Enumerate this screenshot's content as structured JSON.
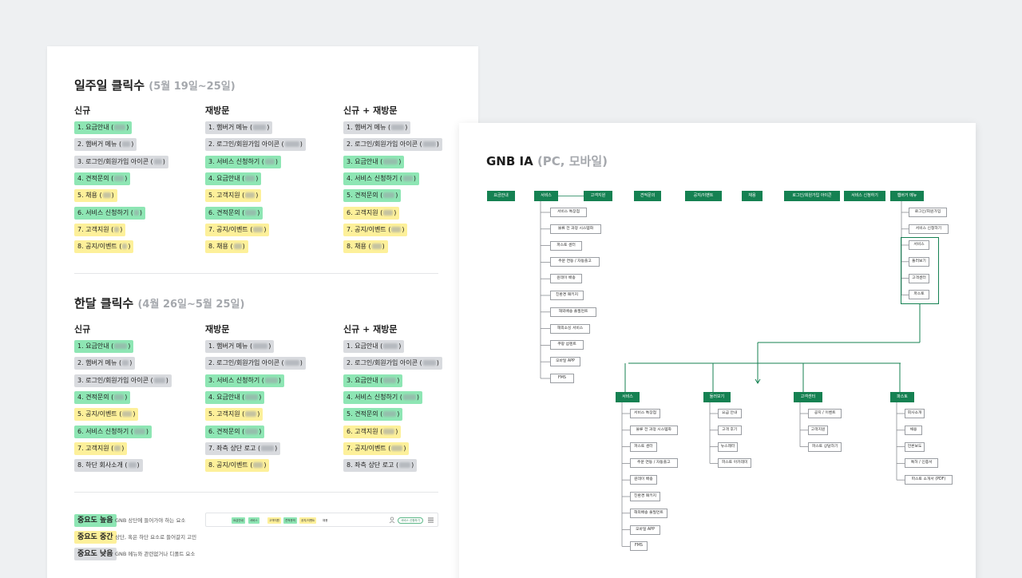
{
  "weekly": {
    "title": "일주일 클릭수",
    "range": "(5월 19일~25일)",
    "columns": [
      {
        "header": "신규",
        "items": [
          {
            "label": "1. 요금안내 (",
            "level": "hi",
            "blur": 14
          },
          {
            "label": "2. 햄버거 메뉴 (",
            "level": "lo",
            "blur": 10
          },
          {
            "label": "3. 로그인/회원가입 아이콘 (",
            "level": "lo",
            "blur": 10
          },
          {
            "label": "4. 견적문의 (",
            "level": "hi",
            "blur": 12
          },
          {
            "label": "5. 채용 (",
            "level": "mid",
            "blur": 10
          },
          {
            "label": "6. 서비스 신청하기 (",
            "level": "hi",
            "blur": 6
          },
          {
            "label": "7. 고객지원 (",
            "level": "mid",
            "blur": 6
          },
          {
            "label": "8. 공지/이벤트 (",
            "level": "mid",
            "blur": 6
          }
        ]
      },
      {
        "header": "재방문",
        "items": [
          {
            "label": "1. 햄버거 메뉴 (",
            "level": "lo",
            "blur": 16
          },
          {
            "label": "2. 로그인/회원가입 아이콘 (",
            "level": "lo",
            "blur": 18
          },
          {
            "label": "3. 서비스 신청하기 (",
            "level": "hi",
            "blur": 12
          },
          {
            "label": "4. 요금안내 (",
            "level": "hi",
            "blur": 12
          },
          {
            "label": "5. 고객지원 (",
            "level": "mid",
            "blur": 12
          },
          {
            "label": "6. 견적문의 (",
            "level": "hi",
            "blur": 14
          },
          {
            "label": "7. 공지/이벤트 (",
            "level": "mid",
            "blur": 12
          },
          {
            "label": "8. 채용 (",
            "level": "mid",
            "blur": 10
          }
        ]
      },
      {
        "header": "신규 + 재방문",
        "items": [
          {
            "label": "1. 햄버거 메뉴 (",
            "level": "lo",
            "blur": 16
          },
          {
            "label": "2. 로그인/회원가입 아이콘 (",
            "level": "lo",
            "blur": 16
          },
          {
            "label": "3. 요금안내 (",
            "level": "hi",
            "blur": 18
          },
          {
            "label": "4. 서비스 신청하기 (",
            "level": "hi",
            "blur": 12
          },
          {
            "label": "5. 견적문의 (",
            "level": "hi",
            "blur": 14
          },
          {
            "label": "6. 고객지원 (",
            "level": "mid",
            "blur": 12
          },
          {
            "label": "7. 공지/이벤트 (",
            "level": "mid",
            "blur": 12
          },
          {
            "label": "8. 채용 (",
            "level": "mid",
            "blur": 12
          }
        ]
      }
    ]
  },
  "monthly": {
    "title": "한달 클릭수",
    "range": "(4월 26일~5월 25일)",
    "columns": [
      {
        "header": "신규",
        "items": [
          {
            "label": "1. 요금안내 (",
            "level": "hi",
            "blur": 16
          },
          {
            "label": "2. 햄버거 메뉴 (",
            "level": "lo",
            "blur": 8
          },
          {
            "label": "3. 로그인/회원가입 아이콘 (",
            "level": "lo",
            "blur": 14
          },
          {
            "label": "4. 견적문의 (",
            "level": "hi",
            "blur": 12
          },
          {
            "label": "5. 공지/이벤트 (",
            "level": "mid",
            "blur": 12
          },
          {
            "label": "6. 서비스 신청하기 (",
            "level": "hi",
            "blur": 14
          },
          {
            "label": "7. 고객지원 (",
            "level": "mid",
            "blur": 8
          },
          {
            "label": "8. 하단 회사소개 (",
            "level": "lo",
            "blur": 10
          }
        ]
      },
      {
        "header": "재방문",
        "items": [
          {
            "label": "1. 햄버거 메뉴 (",
            "level": "lo",
            "blur": 18
          },
          {
            "label": "2. 로그인/회원가입 아이콘 (",
            "level": "lo",
            "blur": 18
          },
          {
            "label": "3. 서비스 신청하기 (",
            "level": "hi",
            "blur": 16
          },
          {
            "label": "4. 요금안내 (",
            "level": "hi",
            "blur": 16
          },
          {
            "label": "5. 고객지원 (",
            "level": "mid",
            "blur": 14
          },
          {
            "label": "6. 견적문의 (",
            "level": "hi",
            "blur": 16
          },
          {
            "label": "7. 좌측 상단 로고 (",
            "level": "lo",
            "blur": 16
          },
          {
            "label": "8. 공지/이벤트 (",
            "level": "mid",
            "blur": 12
          }
        ]
      },
      {
        "header": "신규 + 재방문",
        "items": [
          {
            "label": "1. 요금안내 (",
            "level": "lo",
            "blur": 18
          },
          {
            "label": "2. 로그인/회원가입 아이콘 (",
            "level": "lo",
            "blur": 16
          },
          {
            "label": "3. 요금안내 (",
            "level": "hi",
            "blur": 16
          },
          {
            "label": "4. 서비스 신청하기 (",
            "level": "hi",
            "blur": 16
          },
          {
            "label": "5. 견적문의 (",
            "level": "hi",
            "blur": 16
          },
          {
            "label": "6. 고객지원 (",
            "level": "mid",
            "blur": 14
          },
          {
            "label": "7. 공지/이벤트 (",
            "level": "mid",
            "blur": 14
          },
          {
            "label": "8. 좌측 상단 로고 (",
            "level": "lo",
            "blur": 14
          }
        ]
      }
    ]
  },
  "legend": [
    {
      "badge": "중요도 높음",
      "level": "hi",
      "desc": "GNB 상단에 들어가야 하는 요소"
    },
    {
      "badge": "중요도 중간",
      "level": "mid",
      "desc": "상단, 혹은 하단 요소로 들어갈지 고민"
    },
    {
      "badge": "중요도 낮음",
      "level": "lo",
      "desc": "GNB 메뉴와 관련없거나 디폴트 요소"
    }
  ],
  "gnb_preview": {
    "items": [
      {
        "label": "요금안내",
        "level": "hi"
      },
      {
        "label": "서비스",
        "level": "hi"
      },
      {
        "label": "고객지원",
        "level": "mid"
      },
      {
        "label": "견적문의",
        "level": "hi"
      },
      {
        "label": "공지/이벤트",
        "level": "mid"
      },
      {
        "label": "채용",
        "level": "none"
      }
    ],
    "button": "서비스 신청하기"
  },
  "gnb_ia": {
    "title": "GNB IA",
    "subtitle": "(PC, 모바일)",
    "top_nav": [
      "요금안내",
      "서비스",
      "고객지원",
      "견적문의",
      "공지/이벤트",
      "채용",
      "로그인/회원가입 아이콘",
      "서비스 신청하기",
      "햄버거 메뉴"
    ],
    "service_children": [
      "서비스 특장점",
      "물류 전 과정 시스템화",
      "파스토 센터",
      "주문 연동 / 자동출고",
      "원데이 배송",
      "친환경 패키지",
      "해외배송 풀필먼트",
      "해외소싱 서비스",
      "쿠팡 섬렌트",
      "모바일 APP",
      "FMS"
    ],
    "hamburger_children": [
      "로그인/회원가입",
      "서비스 신청하기"
    ],
    "hamburger_group": [
      "서비스",
      "둘러보기",
      "고객센터",
      "파스토"
    ],
    "sub_trees": [
      {
        "title": "서비스",
        "children": [
          "서비스 특장점",
          "물류 전 과정 시스템화",
          "파스토 센터",
          "주문 연동 / 자동출고",
          "원데이 배송",
          "친환경 패키지",
          "해외배송 풀필먼트",
          "모바일 APP",
          "FMS"
        ]
      },
      {
        "title": "둘러보기",
        "children": [
          "요금 안내",
          "고객 후기",
          "뉴스레터",
          "파스토 아카데미"
        ]
      },
      {
        "title": "고객센터",
        "children": [
          "공지 / 이벤트",
          "고객지원",
          "파스토 상담하기"
        ]
      },
      {
        "title": "파스토",
        "children": [
          "회사소개",
          "채용",
          "언론보도",
          "특허 / 인증서",
          "파스토 소개서 (PDF)"
        ]
      }
    ],
    "colors": {
      "green": "#158152",
      "line": "#158152",
      "box_border": "#9a9da2"
    }
  }
}
